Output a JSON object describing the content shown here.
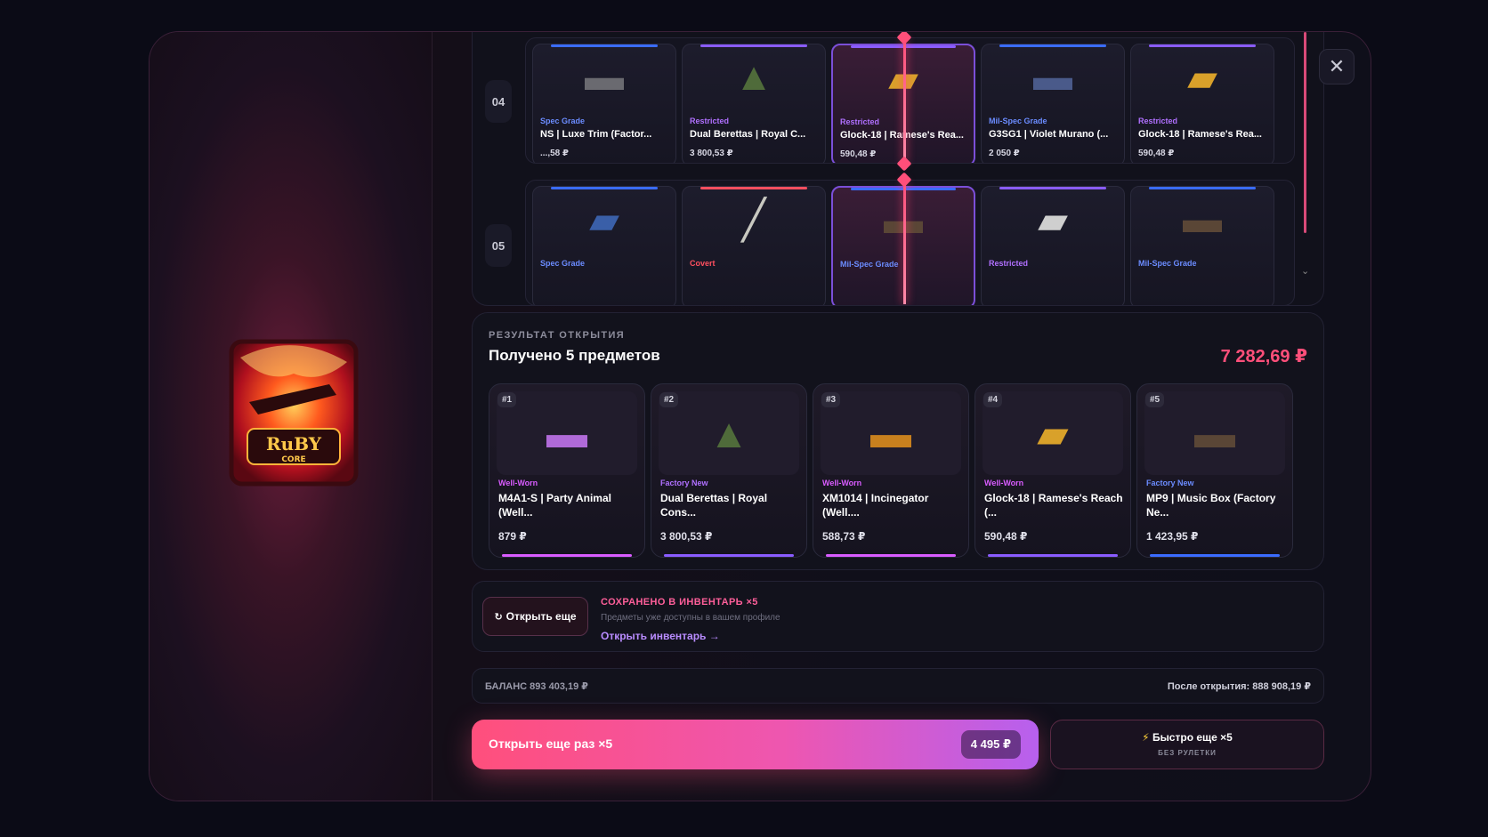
{
  "close": {
    "label": "✕"
  },
  "roulette": {
    "rows": [
      {
        "number": "04",
        "cards": [
          {
            "rarity": "Spec Grade",
            "rarity_color": "#6b8cff",
            "name": "NS | Luxe Trim (Factor...",
            "price": "...,58 ₽",
            "icon": "rifle-icon",
            "glyph": "▬",
            "glyph_color": "#6a6a70",
            "line": "#3a6cff"
          },
          {
            "rarity": "Restricted",
            "rarity_color": "#b070ff",
            "name": "Dual Berettas | Royal C...",
            "price": "3 800,53 ₽",
            "icon": "dual-pistols-icon",
            "glyph": "▲",
            "glyph_color": "#4f6b3a",
            "line": "#8a5cff"
          },
          {
            "rarity": "Restricted",
            "rarity_color": "#b070ff",
            "name": "Glock-18 | Ramese's Rea...",
            "price": "590,48 ₽",
            "icon": "pistol-icon",
            "glyph": "▰",
            "glyph_color": "#d9a12a",
            "line": "#8a5cff",
            "active": true
          },
          {
            "rarity": "Mil-Spec Grade",
            "rarity_color": "#6b8cff",
            "name": "G3SG1 | Violet Murano (...",
            "price": "2 050 ₽",
            "icon": "sniper-icon",
            "glyph": "▬",
            "glyph_color": "#4a5a8a",
            "line": "#3a6cff"
          },
          {
            "rarity": "Restricted",
            "rarity_color": "#b070ff",
            "name": "Glock-18 | Ramese's Rea...",
            "price": "590,48 ₽",
            "icon": "pistol-icon",
            "glyph": "▰",
            "glyph_color": "#d9a12a",
            "line": "#8a5cff"
          }
        ]
      },
      {
        "number": "05",
        "cards": [
          {
            "rarity": "Spec Grade",
            "rarity_color": "#6b8cff",
            "name": "",
            "price": "",
            "icon": "pistol-icon",
            "glyph": "▰",
            "glyph_color": "#3a5fa8",
            "line": "#3a6cff"
          },
          {
            "rarity": "Covert",
            "rarity_color": "#ff4f5f",
            "name": "",
            "price": "",
            "icon": "knife-icon",
            "glyph": "╱",
            "glyph_color": "#c8c8c0",
            "line": "#ff4f5f"
          },
          {
            "rarity": "Mil-Spec Grade",
            "rarity_color": "#6b8cff",
            "name": "",
            "price": "",
            "icon": "smg-icon",
            "glyph": "▬",
            "glyph_color": "#5a4636",
            "line": "#3a6cff",
            "active": true
          },
          {
            "rarity": "Restricted",
            "rarity_color": "#b070ff",
            "name": "",
            "price": "",
            "icon": "pistol-icon",
            "glyph": "▰",
            "glyph_color": "#cfcfcf",
            "line": "#8a5cff"
          },
          {
            "rarity": "Mil-Spec Grade",
            "rarity_color": "#6b8cff",
            "name": "",
            "price": "",
            "icon": "smg-icon",
            "glyph": "▬",
            "glyph_color": "#5a4636",
            "line": "#3a6cff"
          }
        ]
      }
    ]
  },
  "result": {
    "label": "РЕЗУЛЬТАТ ОТКРЫТИЯ",
    "title": "Получено 5 предметов",
    "total": "7 282,69 ₽",
    "items": [
      {
        "index": "#1",
        "wear": "Well-Worn",
        "wear_color": "#d95cff",
        "name": "M4A1-S | Party Animal (Well...",
        "price": "879 ₽",
        "icon": "rifle-icon",
        "glyph": "▬",
        "glyph_color": "#b06ad8",
        "bar": "#d95cff"
      },
      {
        "index": "#2",
        "wear": "Factory New",
        "wear_color": "#b070ff",
        "name": "Dual Berettas | Royal Cons...",
        "price": "3 800,53 ₽",
        "icon": "dual-pistols-icon",
        "glyph": "▲",
        "glyph_color": "#4f6b3a",
        "bar": "#8a5cff"
      },
      {
        "index": "#3",
        "wear": "Well-Worn",
        "wear_color": "#d95cff",
        "name": "XM1014 | Incinegator (Well....",
        "price": "588,73 ₽",
        "icon": "shotgun-icon",
        "glyph": "▬",
        "glyph_color": "#c8801e",
        "bar": "#d95cff"
      },
      {
        "index": "#4",
        "wear": "Well-Worn",
        "wear_color": "#d95cff",
        "name": "Glock-18 | Ramese's Reach (...",
        "price": "590,48 ₽",
        "icon": "pistol-icon",
        "glyph": "▰",
        "glyph_color": "#d9a12a",
        "bar": "#8a5cff"
      },
      {
        "index": "#5",
        "wear": "Factory New",
        "wear_color": "#6b8cff",
        "name": "MP9 | Music Box (Factory Ne...",
        "price": "1 423,95 ₽",
        "icon": "smg-icon",
        "glyph": "▬",
        "glyph_color": "#5a4636",
        "bar": "#3a6cff"
      }
    ]
  },
  "saved": {
    "button": "Открыть еще",
    "title": "СОХРАНЕНО В ИНВЕНТАРЬ ×5",
    "description": "Предметы уже доступны в вашем профиле",
    "link": "Открыть инвентарь →"
  },
  "balance": {
    "left": "БАЛАНС 893 403,19 ₽",
    "right": "После открытия: 888 908,19 ₽"
  },
  "actions": {
    "primary_label": "Открыть еще раз ×5",
    "primary_price": "4 495 ₽",
    "fast_label": "Быстро еще ×5",
    "fast_sub": "БЕЗ РУЛЕТКИ"
  },
  "case": {
    "brand_text": "RUBY CORE"
  }
}
